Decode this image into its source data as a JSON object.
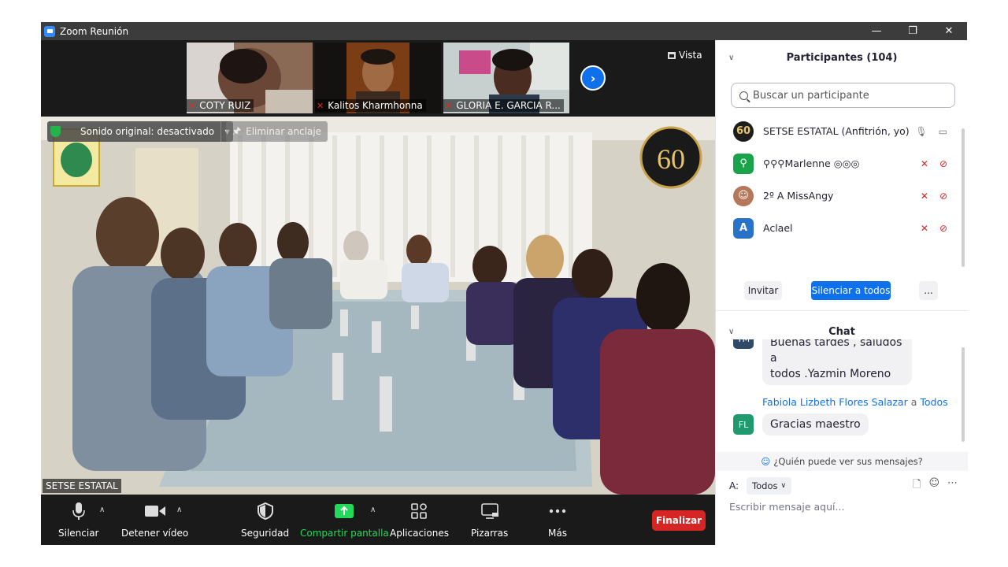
{
  "window": {
    "title": "Zoom Reunión",
    "minimize_glyph": "—",
    "restore_glyph": "❐",
    "close_glyph": "✕"
  },
  "thumbnails": [
    {
      "name": "COTY RUIZ"
    },
    {
      "name": "Kalitos Kharmhonna"
    },
    {
      "name": "GLORIA E. GARCIA R..."
    }
  ],
  "view_button": {
    "label": "Vista"
  },
  "main_video": {
    "speaker_name": "SETSE ESTATAL",
    "audio_status": "Sonido original: desactivado",
    "unpin_label": "Eliminar anclaje",
    "badge_number": "60"
  },
  "toolbar": {
    "mute_label": "Silenciar",
    "video_label": "Detener vídeo",
    "security_label": "Seguridad",
    "share_label": "Compartir pantalla",
    "apps_label": "Aplicaciones",
    "whiteboard_label": "Pizarras",
    "more_label": "Más",
    "end_label": "Finalizar",
    "colors": {
      "share_green": "#23d959",
      "end_red": "#d62525"
    }
  },
  "participants": {
    "header": "Participantes (104)",
    "search_placeholder": "Buscar un participante",
    "items": [
      {
        "name": "SETSE ESTATAL (Anfitrión, yo)",
        "avatar_text": "60",
        "avatar_color": "#1d1d1d",
        "muted": false
      },
      {
        "name": "⚲⚲⚲Marlenne ◎◎◎",
        "avatar_text": "⚲",
        "avatar_color": "#1aa34a",
        "muted": true
      },
      {
        "name": "2º A  MissAngy",
        "avatar_text": "☺",
        "avatar_color": "#b5785a",
        "muted": true
      },
      {
        "name": "Aclael",
        "avatar_text": "A",
        "avatar_color": "#2872c9",
        "muted": true
      }
    ],
    "invite_label": "Invitar",
    "mute_all_label": "Silenciar a todos",
    "more_label": "..."
  },
  "chat": {
    "header": "Chat",
    "messages": [
      {
        "avatar": "YM",
        "avatar_color": "#2f4a69",
        "line1": "Buenas tardes  , saludos a",
        "line2": "todos  .Yazmin Moreno"
      },
      {
        "sender": "Fabiola Lizbeth Flores Salazar",
        "to_word": "a",
        "recipient": "Todos",
        "avatar": "FL",
        "avatar_color": "#1e9a6e",
        "text": "Gracias maestro"
      }
    ],
    "visibility_notice": "¿Quién puede ver sus mensajes?",
    "to_label": "A:",
    "to_value": "Todos",
    "input_placeholder": "Escribir mensaje aquí..."
  }
}
